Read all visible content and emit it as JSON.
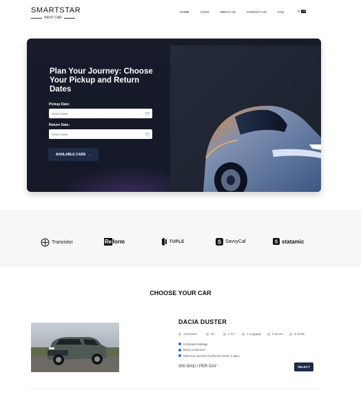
{
  "brand": {
    "name": "SMARTSTAR",
    "tagline": "RENT CAR"
  },
  "nav": {
    "items": [
      {
        "label": "HOME"
      },
      {
        "label": "CARS"
      },
      {
        "label": "ABOUT US"
      },
      {
        "label": "CONTACT US"
      },
      {
        "label": "FAQ"
      }
    ],
    "language": {
      "code": "D",
      "flag_label": "GB"
    }
  },
  "hero": {
    "title": "Plan Your Journey: Choose Your Pickup and Return Dates",
    "pickup_label": "Pickup Date:",
    "pickup_placeholder": "Select Date",
    "return_label": "Return Date:",
    "return_placeholder": "Select Date",
    "button_label": "AVAILABLE CARS",
    "button_arrow": "→"
  },
  "partners": [
    {
      "name": "Transistor",
      "icon": "transistor-icon"
    },
    {
      "name": "Reform",
      "icon": "reform-logo"
    },
    {
      "name": "TUPLE",
      "icon": "tuple-icon"
    },
    {
      "name": "SavvyCal",
      "icon": "savvycal-icon"
    },
    {
      "name": "statamic",
      "icon": "statamic-icon"
    }
  ],
  "section": {
    "title": "CHOOSE YOUR CAR"
  },
  "car": {
    "name": "DACIA DUSTER",
    "specs": [
      "Automatic",
      "No",
      "1 CV",
      "1 Luggage",
      "5 Doors",
      "5 Seats"
    ],
    "features": [
      "Unlimited Mileage",
      "Basic protection",
      "Minimum period of vehicule hired: 2 days"
    ],
    "price": "300 MAD / PER DAY",
    "select_label": "SELECT"
  },
  "colors": {
    "accent": "#1e2a46",
    "hero_bg": "#171b2a",
    "feature_dot": "#2563eb"
  }
}
